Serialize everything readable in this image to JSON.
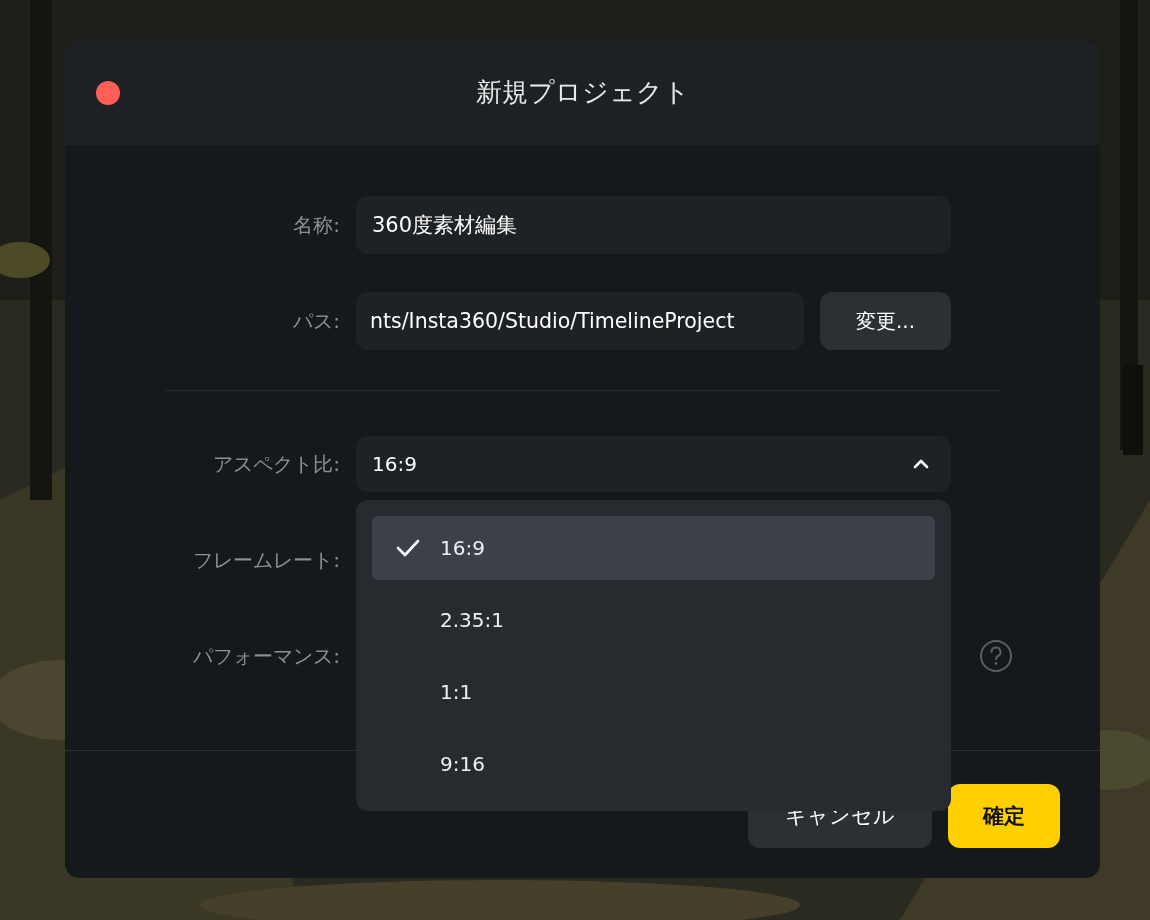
{
  "window": {
    "title": "新規プロジェクト"
  },
  "form": {
    "name": {
      "label": "名称:",
      "value": "360度素材編集"
    },
    "path": {
      "label": "パス:",
      "value": "nts/Insta360/Studio/TimelineProject",
      "button": "変更..."
    },
    "aspect": {
      "label": "アスペクト比:",
      "value": "16:9",
      "expanded": true,
      "options": [
        {
          "label": "16:9",
          "selected": true
        },
        {
          "label": "2.35:1",
          "selected": false
        },
        {
          "label": "1:1",
          "selected": false
        },
        {
          "label": "9:16",
          "selected": false
        }
      ]
    },
    "framerate": {
      "label": "フレームレート:"
    },
    "performance": {
      "label": "パフォーマンス:"
    }
  },
  "buttons": [
    {
      "label": "キャンセル",
      "kind": "secondary"
    },
    {
      "label": "確定",
      "kind": "primary"
    }
  ]
}
